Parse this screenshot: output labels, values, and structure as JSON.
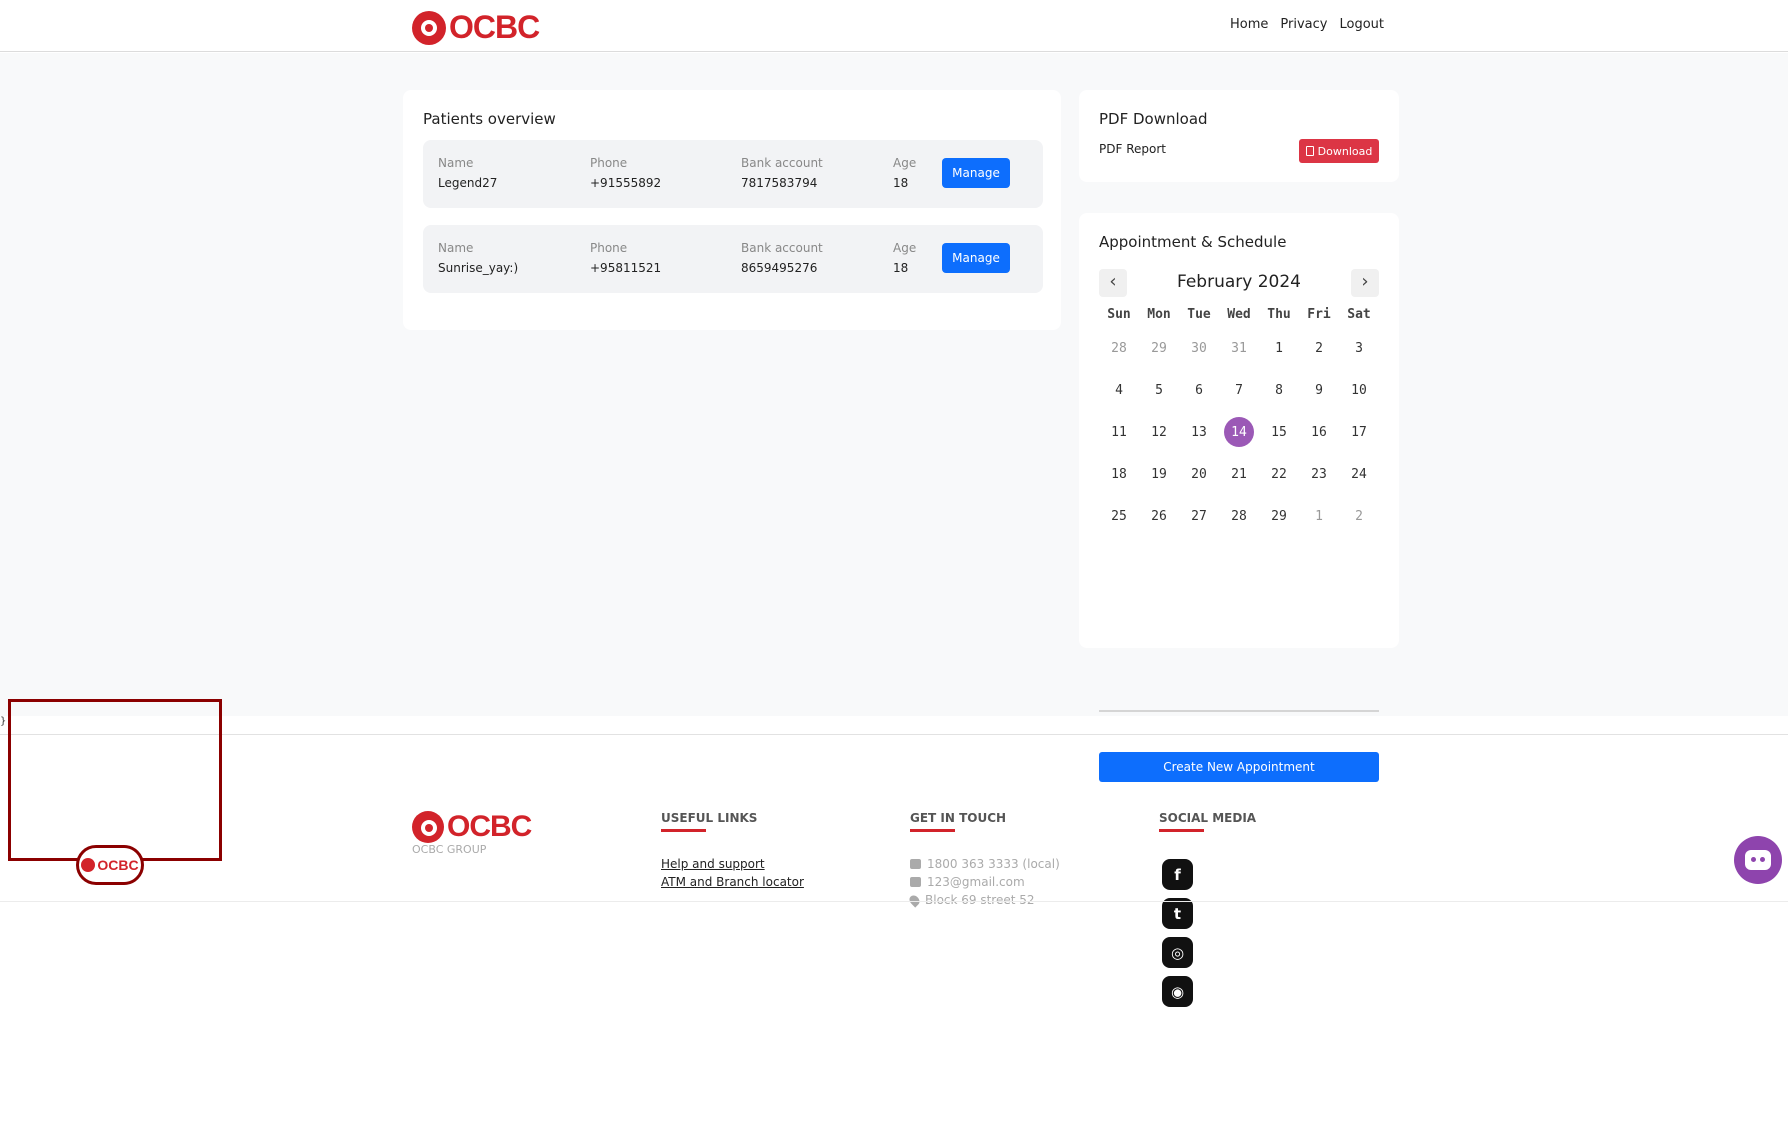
{
  "brand": {
    "logo_text": "OCBC",
    "group_label": "OCBC GROUP",
    "mini_logo_text": "OCBC"
  },
  "nav": {
    "links": [
      "Home",
      "Privacy",
      "Logout"
    ]
  },
  "patients": {
    "title": "Patients overview",
    "labels": {
      "name": "Name",
      "phone": "Phone",
      "bank": "Bank account",
      "age": "Age"
    },
    "manage_label": "Manage",
    "rows": [
      {
        "name": "Legend27",
        "phone": "+91555892",
        "bank": "7817583794",
        "age": "18"
      },
      {
        "name": "Sunrise_yay:)",
        "phone": "+95811521",
        "bank": "8659495276",
        "age": "18"
      }
    ]
  },
  "pdf": {
    "title": "PDF Download",
    "report_label": "PDF Report",
    "download_label": "Download"
  },
  "calendar": {
    "title": "Appointment & Schedule",
    "month": "February 2024",
    "prev_icon": "‹",
    "next_icon": "›",
    "dows": [
      "Sun",
      "Mon",
      "Tue",
      "Wed",
      "Thu",
      "Fri",
      "Sat"
    ],
    "weeks": [
      [
        "28",
        "29",
        "30",
        "31",
        "1",
        "2",
        "3"
      ],
      [
        "4",
        "5",
        "6",
        "7",
        "8",
        "9",
        "10"
      ],
      [
        "11",
        "12",
        "13",
        "14",
        "15",
        "16",
        "17"
      ],
      [
        "18",
        "19",
        "20",
        "21",
        "22",
        "23",
        "24"
      ],
      [
        "25",
        "26",
        "27",
        "28",
        "29",
        "1",
        "2"
      ]
    ],
    "selected_day": "14",
    "selected_color": "#9b59b6",
    "create_label": "Create New Appointment"
  },
  "footer": {
    "brace": "}",
    "useful_title": "USEFUL LINKS",
    "useful_links": [
      "Help and support",
      "ATM and Branch locator"
    ],
    "contact_title": "GET IN TOUCH",
    "contact": {
      "phone": "1800 363 3333 (local)",
      "email": "123@gmail.com",
      "address": "Block 69 street 52"
    },
    "social_title": "SOCIAL MEDIA",
    "social": [
      {
        "icon": "facebook-icon",
        "glyph": "f"
      },
      {
        "icon": "twitter-icon",
        "glyph": "t"
      },
      {
        "icon": "instagram-icon",
        "glyph": "◎"
      },
      {
        "icon": "github-icon",
        "glyph": "◉"
      }
    ]
  },
  "colors": {
    "brand_red": "#d2232a",
    "primary_blue": "#0d6efd",
    "danger_red": "#dc3545",
    "chatbot_purple": "#8e44ad"
  }
}
